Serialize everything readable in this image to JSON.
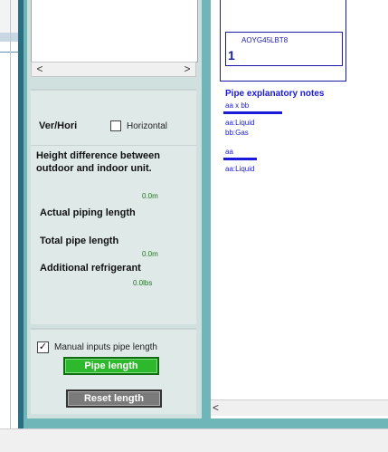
{
  "left_panel": {
    "scroll_left_arrow": "<",
    "scroll_right_arrow": ">",
    "ver_hori_label": "Ver/Hori",
    "horizontal_option": "Horizontal",
    "height_diff_label_line1": "Height difference between",
    "height_diff_label_line2": "outdoor and indoor unit.",
    "height_diff_value": "0.0m",
    "actual_piping_label": "Actual piping length",
    "total_pipe_label": "Total pipe length",
    "total_pipe_value": "0.0m",
    "additional_refrigerant_label": "Additional refrigerant",
    "additional_refrigerant_value": "0.0lbs",
    "manual_inputs_label": "Manual inputs pipe length",
    "manual_inputs_checked": true,
    "pipe_length_button": "Pipe length",
    "reset_length_button": "Reset length"
  },
  "diagram": {
    "unit_model": "AOYG45LBT8",
    "unit_quantity": "1",
    "notes_title": "Pipe explanatory notes",
    "note1_symbol": "aa x bb",
    "note1_line1": "aa:Liquid",
    "note1_line2": "bb:Gas",
    "note2_symbol": "aa",
    "note2_line1": "aa:Liquid",
    "scroll_left_arrow": "<"
  },
  "colors": {
    "frame_teal": "#6fb6b8",
    "note_blue": "#1a1ad8",
    "pipe_button_green": "#2eb82e",
    "reset_button_gray": "#7a7a7a"
  }
}
